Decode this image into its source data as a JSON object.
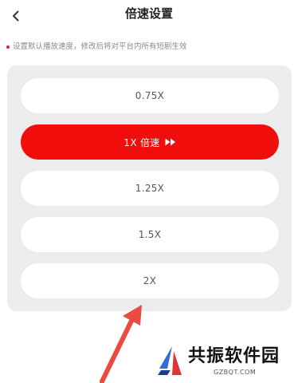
{
  "header": {
    "title": "倍速设置",
    "back_icon": "chevron-left-icon"
  },
  "hint": {
    "text": "设置默认播放速度，修改后将对平台内所有短剧生效"
  },
  "speed_options": [
    {
      "label": "0.75X",
      "selected": false
    },
    {
      "label": "1X 倍速",
      "selected": true
    },
    {
      "label": "1.25X",
      "selected": false
    },
    {
      "label": "1.5X",
      "selected": false
    },
    {
      "label": "2X",
      "selected": false
    }
  ],
  "watermark": {
    "name": "共振软件园",
    "url": "GZBQT.COM"
  },
  "colors": {
    "accent": "#f20d0d",
    "panel_bg": "#ececec",
    "hint_dot": "#e8202a",
    "annotation_arrow": "#ea4a40"
  }
}
